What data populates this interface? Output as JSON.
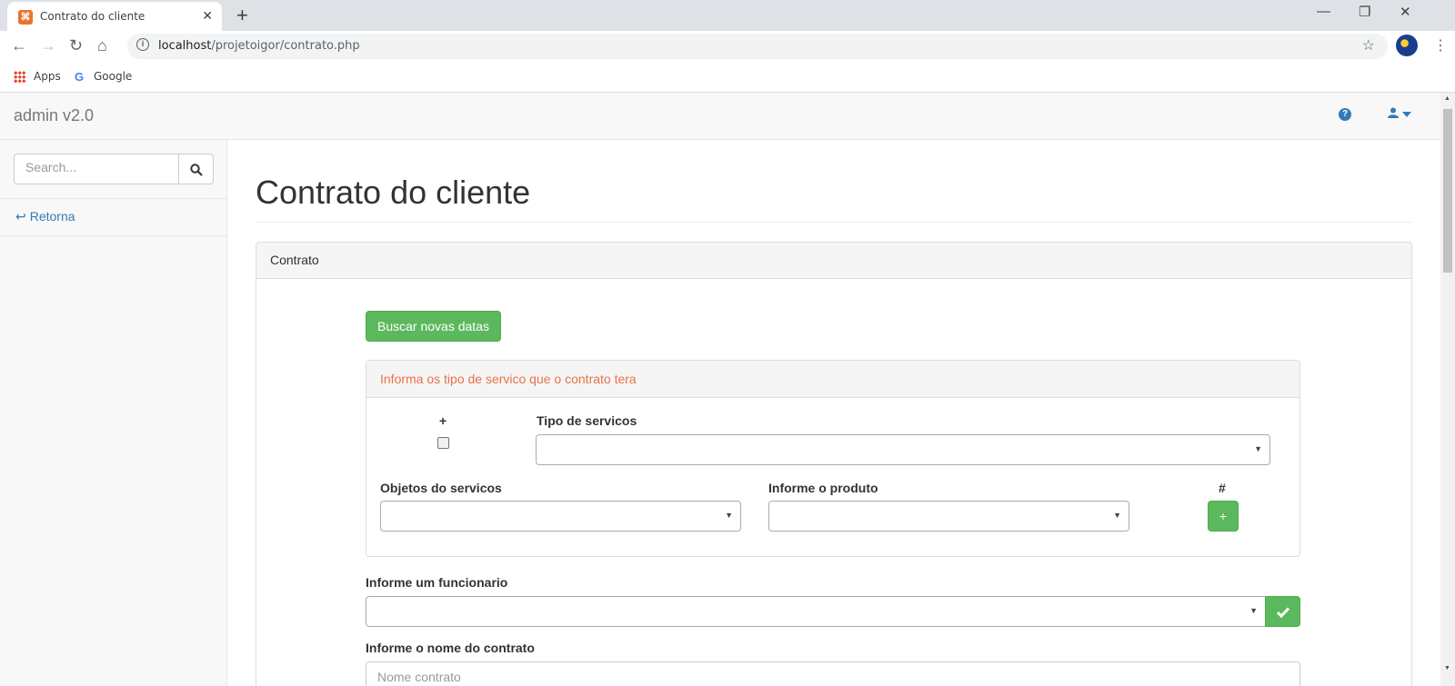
{
  "browser": {
    "tab_title": "Contrato do cliente",
    "tab_favicon": "xampp-icon",
    "url_host": "localhost",
    "url_path": "/projetoigor/contrato.php",
    "bookmarks": [
      "Apps",
      "Google"
    ]
  },
  "navbar": {
    "brand": "admin v2.0"
  },
  "sidebar": {
    "search_placeholder": "Search...",
    "items": [
      {
        "label": "Retorna",
        "icon": "reply-icon"
      }
    ]
  },
  "main": {
    "page_title": "Contrato do cliente",
    "panel_title": "Contrato",
    "btn_new_dates": "Buscar novas datas",
    "services_panel": {
      "heading": "Informa os tipo de servico que o contrato tera",
      "plus_label": "+",
      "tipo_label": "Tipo de servicos",
      "objetos_label": "Objetos do servicos",
      "produto_label": "Informe o produto",
      "hash_label": "#",
      "add_button": "+"
    },
    "funcionario_label": "Informe um funcionario",
    "nome_contrato_label": "Informe o nome do contrato",
    "nome_contrato_placeholder": "Nome contrato"
  },
  "colors": {
    "accent": "#337ab7",
    "success": "#5cb85c",
    "panel_heading_text": "#e8734a"
  }
}
